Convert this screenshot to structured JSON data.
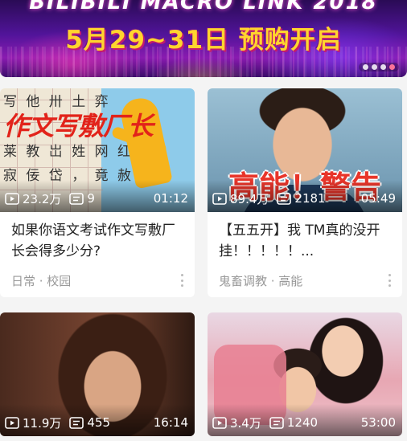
{
  "banner": {
    "top_text": "BILIBILI MACRO LINK 2018",
    "main_text": "5月29~31日 预购开启",
    "indicator_count": 4,
    "indicator_active": 3
  },
  "colors": {
    "accent_pink": "#fb7299",
    "banner_yellow": "#ffd52e",
    "warning_red": "#e8352a"
  },
  "cards": [
    {
      "views": "23.2万",
      "danmaku": "9",
      "duration": "01:12",
      "title": "如果你语文考试作文写敷厂长会得多少分?",
      "thumb_text": "作文写敷厂长",
      "paper_row1": "写 他 卅 土 弈",
      "paper_row2": "莱 教 岀 姓 网 红",
      "paper_row3": "寂 佞 岱 ， 竟 赦",
      "tags": "日常 · 校园"
    },
    {
      "views": "89.4万",
      "danmaku": "2181",
      "duration": "05:49",
      "title": "【五五开】我 TM真的没开挂！！！！！...",
      "thumb_text": "高能！警告",
      "tags": "鬼畜调教 · 高能"
    },
    {
      "views": "11.9万",
      "danmaku": "455",
      "duration": "16:14"
    },
    {
      "views": "3.4万",
      "danmaku": "1240",
      "duration": "53:00"
    }
  ]
}
